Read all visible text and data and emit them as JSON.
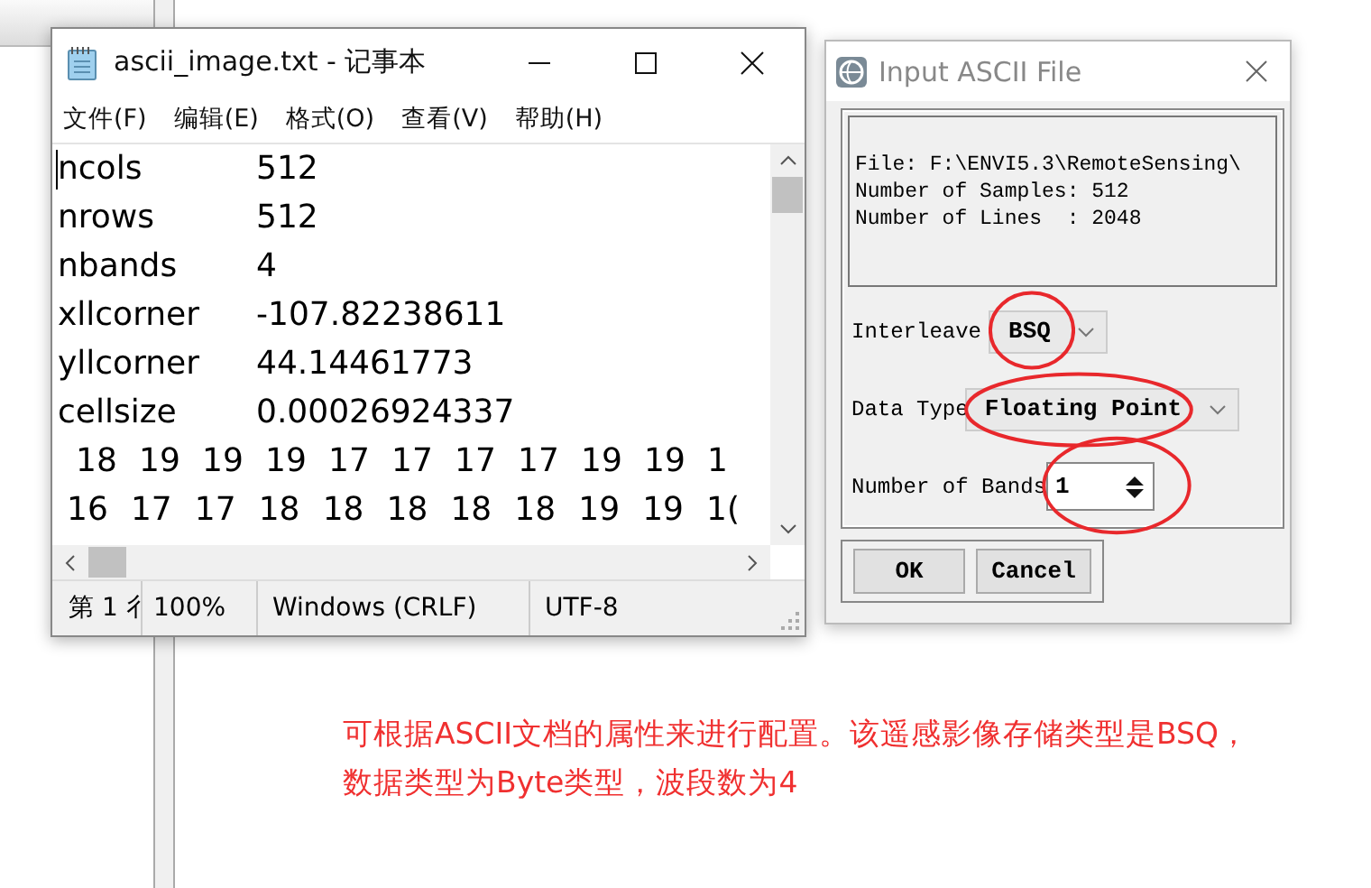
{
  "notepad": {
    "title": "ascii_image.txt - 记事本",
    "menu": [
      "文件(F)",
      "编辑(E)",
      "格式(O)",
      "查看(V)",
      "帮助(H)"
    ],
    "header_lines": [
      {
        "key": "ncols",
        "value": "512"
      },
      {
        "key": "nrows",
        "value": "512"
      },
      {
        "key": "nbands",
        "value": "4"
      },
      {
        "key": "xllcorner",
        "value": "-107.82238611"
      },
      {
        "key": "yllcorner",
        "value": "44.14461773"
      },
      {
        "key": "cellsize",
        "value": "0.00026924337"
      }
    ],
    "data_rows": [
      [
        "18",
        "19",
        "19",
        "19",
        "17",
        "17",
        "17",
        "17",
        "19",
        "19",
        "1"
      ],
      [
        "16",
        "17",
        "17",
        "18",
        "18",
        "18",
        "18",
        "18",
        "19",
        "19",
        "1("
      ]
    ],
    "status_bar": [
      "第 1 彳",
      "100%",
      "Windows (CRLF)",
      "UTF-8"
    ]
  },
  "dialog": {
    "title": "Input ASCII File",
    "info_lines": [
      "File: F:\\ENVI5.3\\RemoteSensing\\",
      "Number of Samples: 512",
      "Number of Lines  : 2048"
    ],
    "fields": [
      {
        "kind": "combo",
        "label": "Interleave",
        "value": "BSQ",
        "circled": true
      },
      {
        "kind": "combo",
        "label": "Data Type",
        "value": "Floating Point",
        "circled": true
      },
      {
        "kind": "spin",
        "label": "Number of Bands",
        "value": "1",
        "circled": true
      }
    ],
    "buttons": [
      "OK",
      "Cancel"
    ]
  },
  "annotation": "可根据ASCII文档的属性来进行配置。该遥感影像存储类型是BSQ，数据类型为Byte类型，波段数为4"
}
